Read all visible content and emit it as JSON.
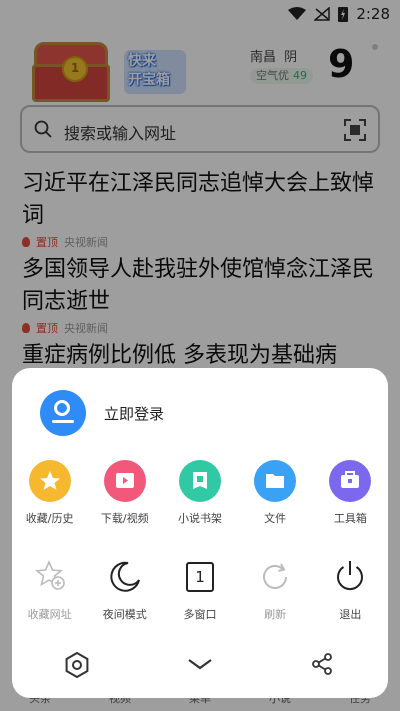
{
  "status_bar": {
    "time": "2:28"
  },
  "promo": {
    "badge_line1": "快来",
    "badge_line2": "开宝箱",
    "coin": "1"
  },
  "weather": {
    "city": "南昌",
    "condition": "阴",
    "air_label": "空气优",
    "aqi": "49",
    "temperature": "9"
  },
  "search": {
    "placeholder": "搜索或输入网址"
  },
  "news": [
    {
      "title": "习近平在江泽民同志追悼大会上致悼词",
      "tag": "置顶",
      "source": "央视新闻"
    },
    {
      "title": "多国领导人赴我驻外使馆悼念江泽民同志逝世",
      "tag": "置顶",
      "source": "央视新闻"
    },
    {
      "title": "重症病例比例低 多表现为基础病"
    }
  ],
  "bottom_nav": [
    "头条",
    "视频",
    "菜单",
    "小说",
    "任务"
  ],
  "menu": {
    "login_label": "立即登录",
    "row1": [
      {
        "label": "收藏/历史",
        "icon": "star-icon",
        "color": "#f5b82e"
      },
      {
        "label": "下载/视频",
        "icon": "play-icon",
        "color": "#f2587a"
      },
      {
        "label": "小说书架",
        "icon": "book-icon",
        "color": "#31c9a3"
      },
      {
        "label": "文件",
        "icon": "folder-icon",
        "color": "#3aa2f5"
      },
      {
        "label": "工具箱",
        "icon": "toolbox-icon",
        "color": "#7c68ee"
      }
    ],
    "row2": [
      {
        "label": "收藏网址",
        "icon": "star-add-icon",
        "disabled": true
      },
      {
        "label": "夜间模式",
        "icon": "moon-icon",
        "disabled": false
      },
      {
        "label": "多窗口",
        "icon": "window-count-icon",
        "count": "1",
        "disabled": false
      },
      {
        "label": "刷新",
        "icon": "refresh-icon",
        "disabled": true
      },
      {
        "label": "退出",
        "icon": "power-icon",
        "disabled": false
      }
    ]
  }
}
